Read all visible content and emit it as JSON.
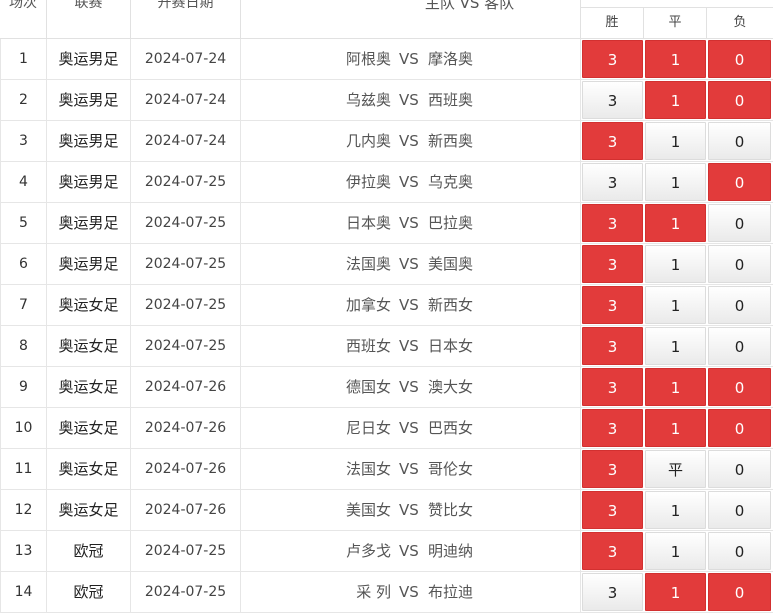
{
  "header": {
    "no": "场次",
    "league": "联赛",
    "date": "开赛日期",
    "match": "主队 VS 客队",
    "win": "胜",
    "draw": "平",
    "lose": "负"
  },
  "colors": {
    "selected": "#e23b3b",
    "unselected": "#f2f2f2"
  },
  "rows": [
    {
      "no": "1",
      "league": "奥运男足",
      "date": "2024-07-24",
      "home": "阿根奥",
      "vs": "VS",
      "away": "摩洛奥",
      "win": "3",
      "draw": "1",
      "lose": "0",
      "win_sel": true,
      "draw_sel": true,
      "lose_sel": true
    },
    {
      "no": "2",
      "league": "奥运男足",
      "date": "2024-07-24",
      "home": "乌兹奥",
      "vs": "VS",
      "away": "西班奥",
      "win": "3",
      "draw": "1",
      "lose": "0",
      "win_sel": false,
      "draw_sel": true,
      "lose_sel": true
    },
    {
      "no": "3",
      "league": "奥运男足",
      "date": "2024-07-24",
      "home": "几内奥",
      "vs": "VS",
      "away": "新西奥",
      "win": "3",
      "draw": "1",
      "lose": "0",
      "win_sel": true,
      "draw_sel": false,
      "lose_sel": false
    },
    {
      "no": "4",
      "league": "奥运男足",
      "date": "2024-07-25",
      "home": "伊拉奥",
      "vs": "VS",
      "away": "乌克奥",
      "win": "3",
      "draw": "1",
      "lose": "0",
      "win_sel": false,
      "draw_sel": false,
      "lose_sel": true
    },
    {
      "no": "5",
      "league": "奥运男足",
      "date": "2024-07-25",
      "home": "日本奥",
      "vs": "VS",
      "away": "巴拉奥",
      "win": "3",
      "draw": "1",
      "lose": "0",
      "win_sel": true,
      "draw_sel": true,
      "lose_sel": false
    },
    {
      "no": "6",
      "league": "奥运男足",
      "date": "2024-07-25",
      "home": "法国奥",
      "vs": "VS",
      "away": "美国奥",
      "win": "3",
      "draw": "1",
      "lose": "0",
      "win_sel": true,
      "draw_sel": false,
      "lose_sel": false
    },
    {
      "no": "7",
      "league": "奥运女足",
      "date": "2024-07-25",
      "home": "加拿女",
      "vs": "VS",
      "away": "新西女",
      "win": "3",
      "draw": "1",
      "lose": "0",
      "win_sel": true,
      "draw_sel": false,
      "lose_sel": false
    },
    {
      "no": "8",
      "league": "奥运女足",
      "date": "2024-07-25",
      "home": "西班女",
      "vs": "VS",
      "away": "日本女",
      "win": "3",
      "draw": "1",
      "lose": "0",
      "win_sel": true,
      "draw_sel": false,
      "lose_sel": false
    },
    {
      "no": "9",
      "league": "奥运女足",
      "date": "2024-07-26",
      "home": "德国女",
      "vs": "VS",
      "away": "澳大女",
      "win": "3",
      "draw": "1",
      "lose": "0",
      "win_sel": true,
      "draw_sel": true,
      "lose_sel": true
    },
    {
      "no": "10",
      "league": "奥运女足",
      "date": "2024-07-26",
      "home": "尼日女",
      "vs": "VS",
      "away": "巴西女",
      "win": "3",
      "draw": "1",
      "lose": "0",
      "win_sel": true,
      "draw_sel": true,
      "lose_sel": true
    },
    {
      "no": "11",
      "league": "奥运女足",
      "date": "2024-07-26",
      "home": "法国女",
      "vs": "VS",
      "away": "哥伦女",
      "win": "3",
      "draw": "平",
      "lose": "0",
      "win_sel": true,
      "draw_sel": false,
      "lose_sel": false
    },
    {
      "no": "12",
      "league": "奥运女足",
      "date": "2024-07-26",
      "home": "美国女",
      "vs": "VS",
      "away": "赞比女",
      "win": "3",
      "draw": "1",
      "lose": "0",
      "win_sel": true,
      "draw_sel": false,
      "lose_sel": false
    },
    {
      "no": "13",
      "league": "欧冠",
      "date": "2024-07-25",
      "home": "卢多戈",
      "vs": "VS",
      "away": "明迪纳",
      "win": "3",
      "draw": "1",
      "lose": "0",
      "win_sel": true,
      "draw_sel": false,
      "lose_sel": false
    },
    {
      "no": "14",
      "league": "欧冠",
      "date": "2024-07-25",
      "home": "采 列",
      "vs": "VS",
      "away": "布拉迪",
      "win": "3",
      "draw": "1",
      "lose": "0",
      "win_sel": false,
      "draw_sel": true,
      "lose_sel": true
    }
  ]
}
